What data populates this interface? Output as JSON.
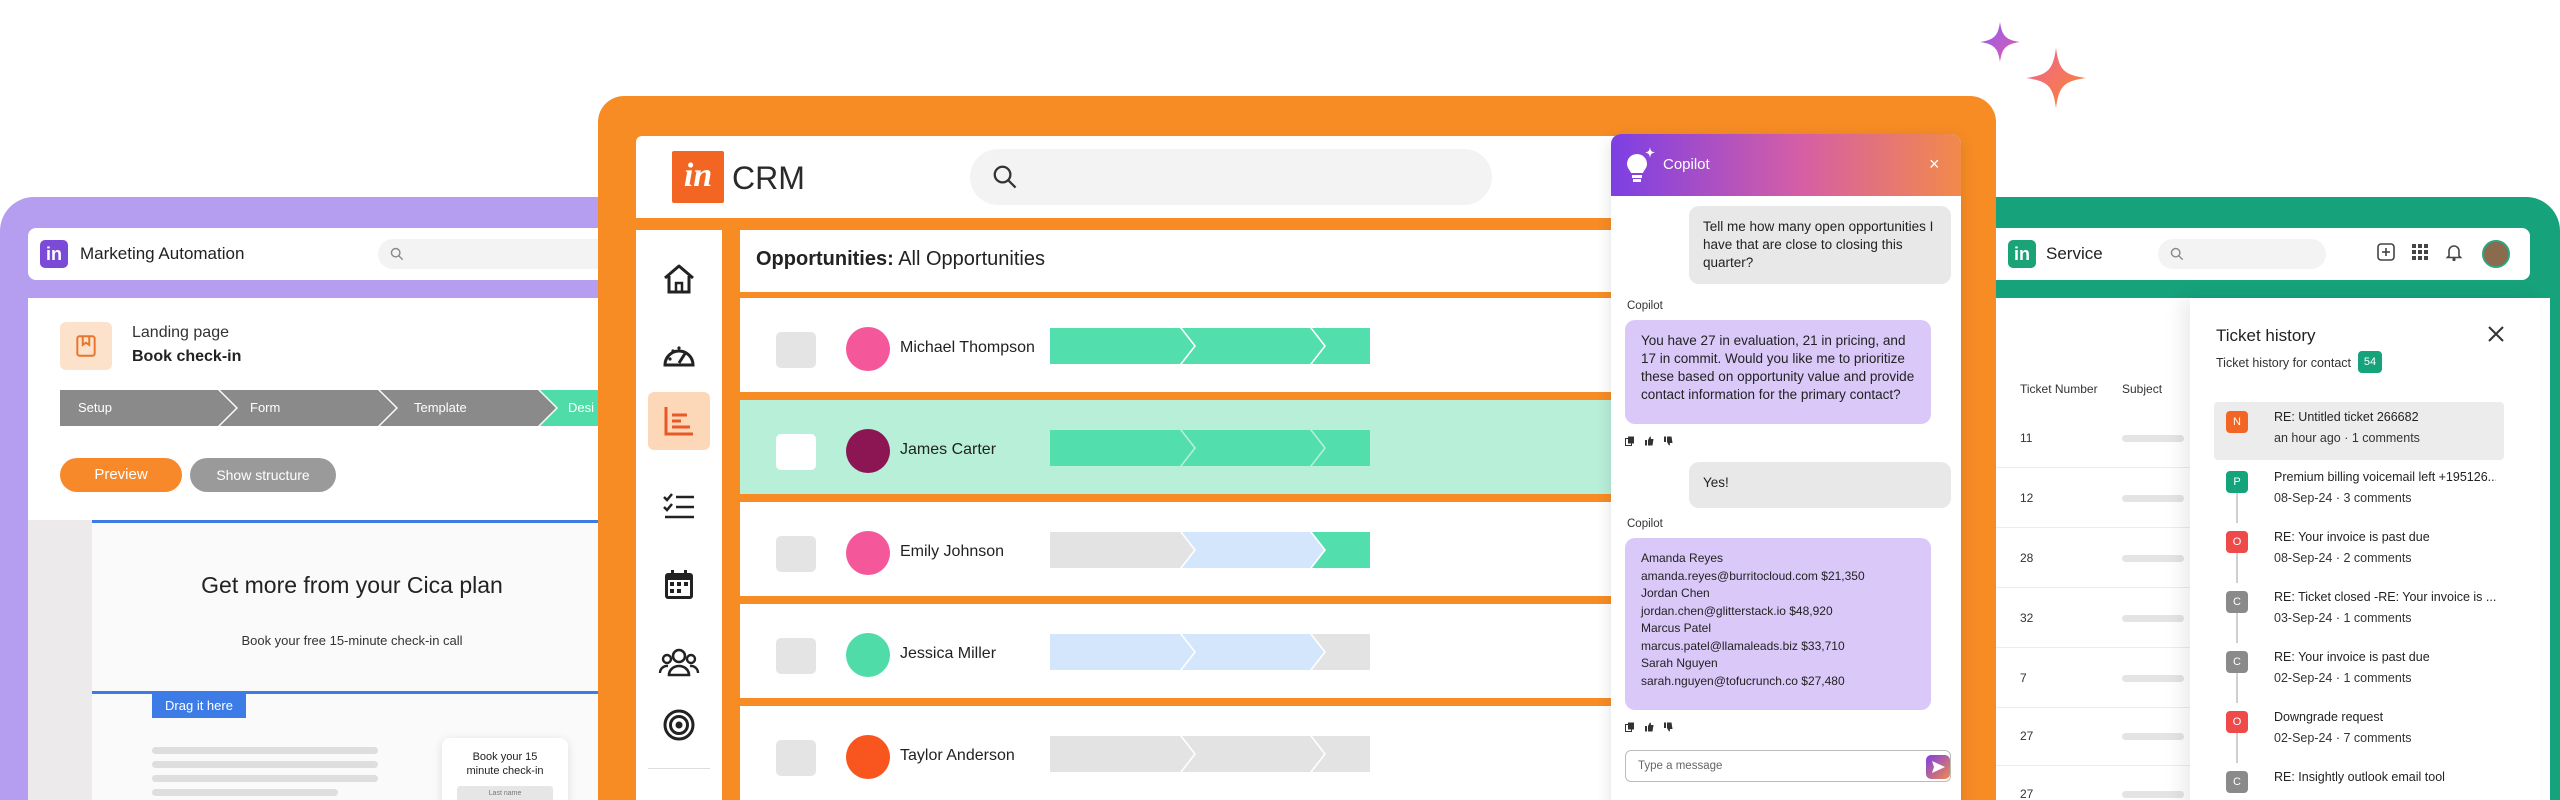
{
  "colors": {
    "marketing_frame": "#b59df0",
    "crm_frame": "#f78c25",
    "service_frame": "#16a27a",
    "progress_green": "#52dfad",
    "progress_blue": "#d4e6fb",
    "progress_grey": "#e3e3e3"
  },
  "marketing": {
    "logo": "in",
    "title": "Marketing Automation",
    "landing_label": "Landing page",
    "landing_name": "Book check-in",
    "steps": [
      "Setup",
      "Form",
      "Template",
      "Desi"
    ],
    "preview_button": "Preview",
    "structure_button": "Show structure",
    "canvas_heading": "Get more from your Cica plan",
    "canvas_sub": "Book your free 15-minute check-in call",
    "drag_tag": "Drag it here",
    "mini_card_text": "Book your 15 minute check-in",
    "mini_card_bar": "Last name"
  },
  "crm": {
    "logo": "in",
    "app_name": "CRM",
    "opp_title_bold": "Opportunities:",
    "opp_title_rest": " All Opportunities",
    "nav_icons": [
      "home-icon",
      "dashboard-gauge-icon",
      "reports-chart-icon",
      "tasks-list-icon",
      "calendar-icon",
      "contacts-icon",
      "goals-target-icon"
    ],
    "rows": [
      {
        "name": "Michael Thompson",
        "avatar": "#f5579b",
        "stages": [
          "green",
          "green",
          "green",
          "green",
          "green"
        ]
      },
      {
        "name": "James Carter",
        "avatar": "#8c1553",
        "stages": [
          "green",
          "green",
          "green",
          "green",
          "green"
        ]
      },
      {
        "name": "Emily Johnson",
        "avatar": "#f5579b",
        "stages": [
          "grey",
          "blue",
          "green",
          "green",
          "green"
        ]
      },
      {
        "name": "Jessica Miller",
        "avatar": "#4fdca8",
        "stages": [
          "blue",
          "blue",
          "grey",
          "grey",
          "grey"
        ]
      },
      {
        "name": "Taylor Anderson",
        "avatar": "#f8561e",
        "stages": [
          "grey",
          "grey",
          "grey",
          "grey",
          "grey"
        ]
      }
    ]
  },
  "copilot": {
    "title": "Copilot",
    "close": "×",
    "user_msg_1": "Tell me how many open opportunities I have that are close to closing this quarter?",
    "label_1": "Copilot",
    "bot_msg_1": "You have 27 in evaluation, 21 in pricing, and 17 in commit. Would you like me to prioritize these based on opportunity value and provide contact information for the primary contact?",
    "user_msg_2": "Yes!",
    "label_2": "Copilot",
    "contacts": [
      "Amanda Reyes",
      "amanda.reyes@burritocloud.com $21,350",
      "Jordan Chen",
      "jordan.chen@glitterstack.io $48,920",
      "Marcus Patel",
      "marcus.patel@llamaleads.biz $33,710",
      "Sarah Nguyen",
      "sarah.nguyen@tofucrunch.co $27,480"
    ],
    "input_placeholder": "Type a message"
  },
  "service": {
    "logo": "in",
    "title": "Service",
    "col_ticket_number": "Ticket Number",
    "col_subject": "Subject",
    "ticket_numbers": [
      "11",
      "12",
      "28",
      "32",
      "7",
      "27",
      "27"
    ],
    "history_title": "Ticket history",
    "history_sub": "Ticket history for contact",
    "history_count": "54",
    "history": [
      {
        "icon": "N",
        "color": "#f26522",
        "title": "RE: Untitled ticket 266682",
        "meta": "an hour ago · 1 comments"
      },
      {
        "icon": "P",
        "color": "#14a37a",
        "title": "Premium billing voicemail left +195126...",
        "meta": "08-Sep-24 · 3 comments"
      },
      {
        "icon": "O",
        "color": "#ef4a4a",
        "title": "RE: Your invoice is past due",
        "meta": "08-Sep-24 · 2 comments"
      },
      {
        "icon": "C",
        "color": "#8a8a8a",
        "title": "RE: Ticket closed -RE: Your invoice is ...",
        "meta": "03-Sep-24 · 1 comments"
      },
      {
        "icon": "C",
        "color": "#8a8a8a",
        "title": "RE: Your invoice is past due",
        "meta": "02-Sep-24 · 1 comments"
      },
      {
        "icon": "O",
        "color": "#ef4a4a",
        "title": "Downgrade request",
        "meta": "02-Sep-24 · 7 comments"
      },
      {
        "icon": "C",
        "color": "#8a8a8a",
        "title": "RE: Insightly outlook email tool",
        "meta": ""
      }
    ]
  }
}
